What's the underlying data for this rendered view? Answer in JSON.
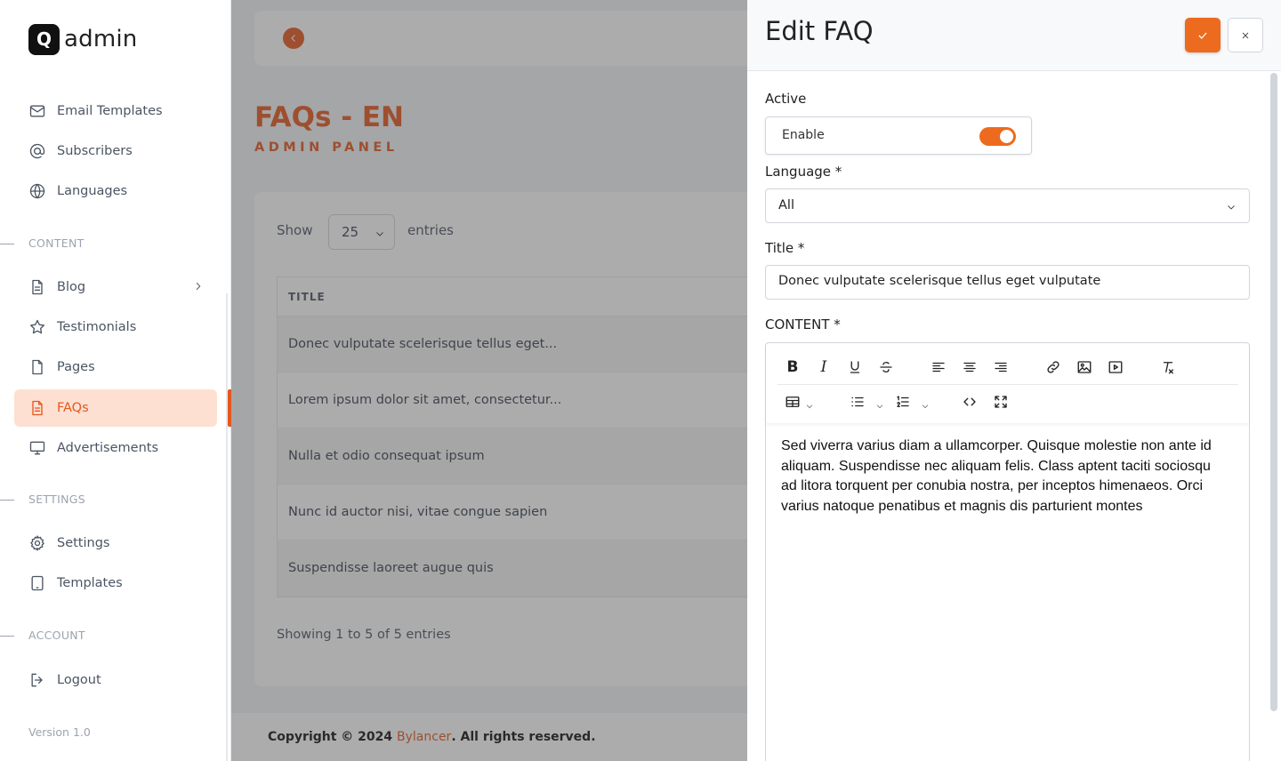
{
  "brand": {
    "badge": "Q",
    "name": "admin"
  },
  "sidebar": {
    "items_top": [
      {
        "label": "Email Templates",
        "icon": "mail-icon"
      },
      {
        "label": "Subscribers",
        "icon": "at-icon"
      },
      {
        "label": "Languages",
        "icon": "globe-icon"
      }
    ],
    "section_content": "CONTENT",
    "items_content": [
      {
        "label": "Blog",
        "icon": "document-icon"
      },
      {
        "label": "Testimonials",
        "icon": "star-icon"
      },
      {
        "label": "Pages",
        "icon": "file-icon"
      },
      {
        "label": "FAQs",
        "icon": "document-icon"
      },
      {
        "label": "Advertisements",
        "icon": "monitor-icon"
      }
    ],
    "section_settings": "SETTINGS",
    "items_settings": [
      {
        "label": "Settings",
        "icon": "gear-icon"
      },
      {
        "label": "Templates",
        "icon": "tablet-icon"
      }
    ],
    "section_account": "ACCOUNT",
    "items_account": [
      {
        "label": "Logout",
        "icon": "logout-icon"
      }
    ],
    "version": "Version 1.0",
    "active_item": "FAQs"
  },
  "main": {
    "title": "FAQs - EN",
    "subtitle": "ADMIN PANEL",
    "show_label": "Show",
    "page_size": "25",
    "entries_label": "entries",
    "table_header": "TITLE",
    "rows": [
      "Donec vulputate scelerisque tellus eget...",
      "Lorem ipsum dolor sit amet, consectetur...",
      "Nulla et odio consequat ipsum",
      "Nunc id auctor nisi, vitae congue sapien",
      "Suspendisse laoreet augue quis"
    ],
    "showing": "Showing 1 to 5 of 5 entries",
    "footer": {
      "prefix": "Copyright © 2024 ",
      "brand": "Bylancer",
      "suffix": ". All rights reserved."
    }
  },
  "drawer": {
    "title": "Edit FAQ",
    "active_label": "Active",
    "enable_label": "Enable",
    "enabled": true,
    "language_label": "Language *",
    "language_value": "All",
    "title_label": "Title *",
    "title_value": "Donec vulputate scelerisque tellus eget vulputate",
    "content_label": "CONTENT *",
    "content_text": "Sed viverra varius diam a ullamcorper. Quisque molestie non ante id aliquam. Suspendisse nec aliquam felis. Class aptent taciti sociosqu ad litora torquent per conubia nostra, per inceptos himenaeos. Orci varius natoque penatibus et magnis dis parturient montes"
  },
  "colors": {
    "accent": "#e4571e",
    "button": "#ec6b1e",
    "active_bg": "#fde0d2"
  }
}
